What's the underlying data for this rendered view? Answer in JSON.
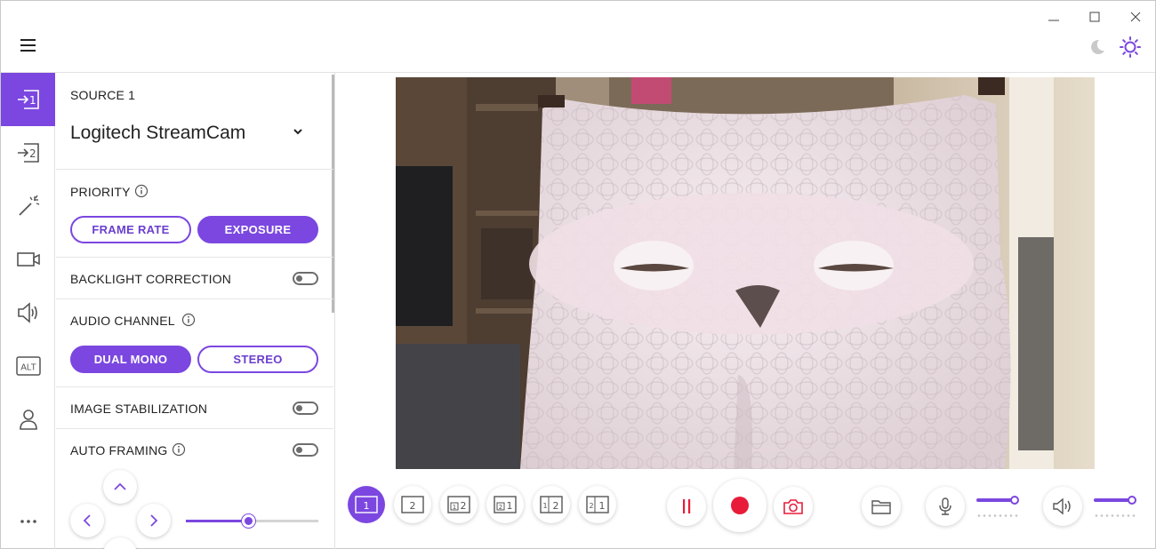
{
  "window": {
    "controls": [
      "minimize-icon",
      "maximize-icon",
      "close-icon"
    ],
    "menu_icon": "hamburger-menu-icon",
    "theme": {
      "dark_icon": "moon-icon",
      "light_icon": "sun-icon",
      "selected": "light"
    }
  },
  "accent_color": "#7b47e0",
  "rail": {
    "items": [
      {
        "icon": "source-1-icon",
        "active": true
      },
      {
        "icon": "source-2-icon",
        "active": false
      },
      {
        "icon": "effects-wand-icon",
        "active": false
      },
      {
        "icon": "camera-icon",
        "active": false
      },
      {
        "icon": "speaker-icon",
        "active": false
      },
      {
        "icon": "alt-icon",
        "label": "ALT",
        "active": false
      },
      {
        "icon": "account-icon",
        "active": false
      }
    ],
    "more_icon": "more-dots-icon"
  },
  "panel": {
    "source_label": "SOURCE 1",
    "source_value": "Logitech StreamCam",
    "priority": {
      "label": "PRIORITY",
      "options": [
        "FRAME RATE",
        "EXPOSURE"
      ],
      "selected": "EXPOSURE"
    },
    "backlight": {
      "label": "BACKLIGHT CORRECTION",
      "on": false
    },
    "audio_channel": {
      "label": "AUDIO CHANNEL",
      "options": [
        "DUAL MONO",
        "STEREO"
      ],
      "selected": "DUAL MONO"
    },
    "image_stabilization": {
      "label": "IMAGE STABILIZATION",
      "on": false
    },
    "auto_framing": {
      "label": "AUTO FRAMING",
      "on": false
    },
    "zoom_level": 0.47
  },
  "toolbar": {
    "layouts": [
      {
        "name": "layout-source-1",
        "active": true
      },
      {
        "name": "layout-source-2",
        "active": false
      },
      {
        "name": "layout-pip-1-2",
        "active": false
      },
      {
        "name": "layout-pip-2-1",
        "active": false
      },
      {
        "name": "layout-side-1-2",
        "active": false
      },
      {
        "name": "layout-side-2-1",
        "active": false
      }
    ],
    "actions": [
      "pause-icon",
      "record-icon",
      "snapshot-camera-icon",
      "folder-icon"
    ],
    "mic_level": 0.95,
    "speaker_level": 0.95,
    "record_color": "#e81c3a"
  }
}
